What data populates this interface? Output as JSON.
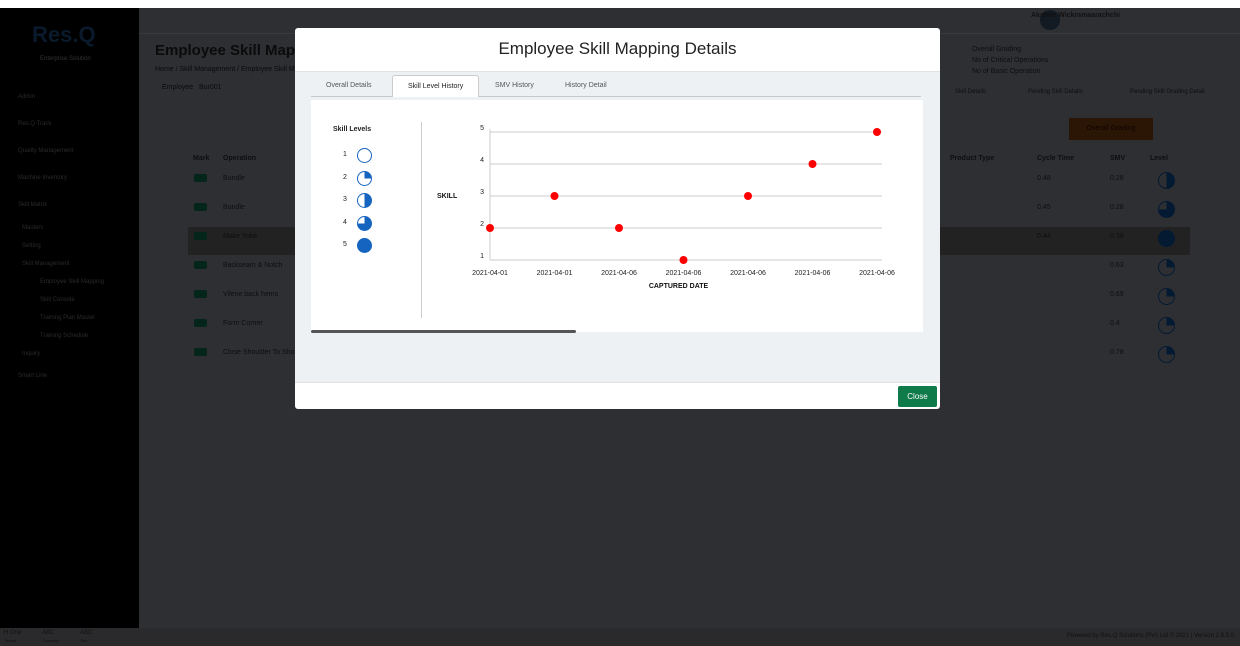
{
  "app": {
    "logo": "Res.Q",
    "logo_sub": "Enterprise Solution",
    "nav": [
      {
        "label": "Admin",
        "cls": ""
      },
      {
        "label": "Res.Q Track",
        "cls": ""
      },
      {
        "label": "Quality Management",
        "cls": ""
      },
      {
        "label": "Machine Inventory",
        "cls": ""
      },
      {
        "label": "Skill Matrix",
        "cls": ""
      },
      {
        "label": "Masters",
        "cls": "sub"
      },
      {
        "label": "Setting",
        "cls": "sub"
      },
      {
        "label": "Skill Management",
        "cls": "sub"
      },
      {
        "label": "Employee Skill Mapping",
        "cls": "sub2"
      },
      {
        "label": "Skill Console",
        "cls": "sub2"
      },
      {
        "label": "Training Plan Master",
        "cls": "sub2"
      },
      {
        "label": "Training Schedule",
        "cls": "sub2"
      },
      {
        "label": "Inquiry",
        "cls": "sub"
      },
      {
        "label": "Smart Line",
        "cls": ""
      }
    ],
    "user_name": "Akshan Wickramaarachchi",
    "page_title": "Employee Skill Mapping",
    "breadcrumb": "Home / Skill Management / Employee Skill Mapping",
    "employee_label": "Employee",
    "employee_value": "Bur001",
    "grading_info": [
      "Overall Grading",
      "No of Critical Operations",
      "No of Basic Operation"
    ],
    "bg_tabs": [
      "Skill Details",
      "Pending Skill Details",
      "Pending Skill Grading Detail"
    ],
    "overall_grading_button": "Overall Grading",
    "columns": [
      "Mark",
      "Operation",
      "Product Type",
      "Cycle Time",
      "SMV",
      "Level"
    ],
    "rows": [
      {
        "op": "Bundle",
        "ct": "0.48",
        "smv": "0.28",
        "level": 3
      },
      {
        "op": "Bundle",
        "ct": "0.45",
        "smv": "0.28",
        "level": 4
      },
      {
        "op": "Make Yoke",
        "ct": "0.44",
        "smv": "0.38",
        "level": 5
      },
      {
        "op": "Backseam & Notch",
        "ct": "",
        "smv": "0.63",
        "level": 2
      },
      {
        "op": "Vilene back hems",
        "ct": "",
        "smv": "0.69",
        "level": 2
      },
      {
        "op": "Form Corner",
        "ct": "",
        "smv": "0.4",
        "level": 2
      },
      {
        "op": "Close Shoulder To Shoulder",
        "ct": "",
        "smv": "0.78",
        "level": 2
      }
    ],
    "footer_left": [
      {
        "v": "H One",
        "l": "Tenant"
      },
      {
        "v": "ABC",
        "l": "Company"
      },
      {
        "v": "ABC",
        "l": "Site"
      }
    ],
    "footer_right": "Powered by Res.Q Solutions (Pvt) Ltd © 2021 | Version 2.8.5.0"
  },
  "modal": {
    "title": "Employee Skill Mapping Details",
    "tabs": [
      "Overall Details",
      "Skill Level History",
      "SMV History",
      "History Detail"
    ],
    "active_tab": "Skill Level History",
    "legend_title": "Skill Levels",
    "legend_levels": [
      "1",
      "2",
      "3",
      "4",
      "5"
    ],
    "close_label": "Close"
  },
  "colors": {
    "accent": "#1565c0",
    "point": "#ff0000",
    "close": "#0f7a4a",
    "grading": "#c25a0a"
  },
  "chart_data": {
    "type": "scatter",
    "xlabel": "CAPTURED DATE",
    "ylabel": "SKILL",
    "x": [
      "2021-04-01",
      "2021-04-01",
      "2021-04-06",
      "2021-04-06",
      "2021-04-06",
      "2021-04-06",
      "2021-04-06"
    ],
    "values": [
      2,
      3,
      2,
      1,
      3,
      4,
      5
    ],
    "yticks": [
      "1",
      "2",
      "3",
      "4",
      "5"
    ],
    "ylim": [
      1,
      5
    ],
    "grid": true
  }
}
